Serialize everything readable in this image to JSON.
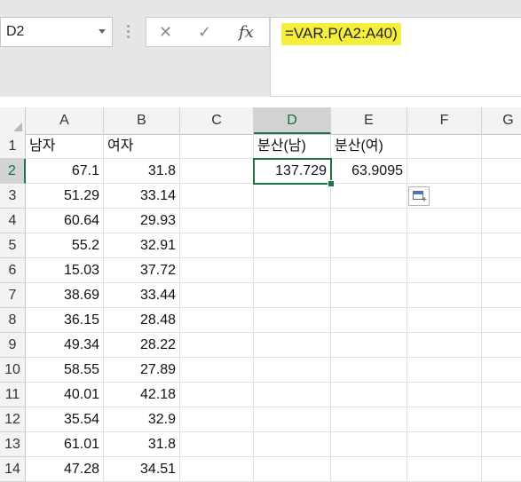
{
  "name_box": {
    "value": "D2"
  },
  "formula_bar": {
    "cancel_icon": "✕",
    "enter_icon": "✓",
    "fx_label": "fx",
    "formula": "=VAR.P(A2:A40)",
    "highlight_color": "#f5ee3a"
  },
  "columns": [
    "A",
    "B",
    "C",
    "D",
    "E",
    "F",
    "G"
  ],
  "rows": [
    {
      "num": "1",
      "a": "남자",
      "b": "여자",
      "d": "분산(남)",
      "e": "분산(여)"
    },
    {
      "num": "2",
      "a": "67.1",
      "b": "31.8",
      "d": "137.729",
      "e": "63.9095"
    },
    {
      "num": "3",
      "a": "51.29",
      "b": "33.14"
    },
    {
      "num": "4",
      "a": "60.64",
      "b": "29.93"
    },
    {
      "num": "5",
      "a": "55.2",
      "b": "32.91"
    },
    {
      "num": "6",
      "a": "15.03",
      "b": "37.72"
    },
    {
      "num": "7",
      "a": "38.69",
      "b": "33.44"
    },
    {
      "num": "8",
      "a": "36.15",
      "b": "28.48"
    },
    {
      "num": "9",
      "a": "49.34",
      "b": "28.22"
    },
    {
      "num": "10",
      "a": "58.55",
      "b": "27.89"
    },
    {
      "num": "11",
      "a": "40.01",
      "b": "42.18"
    },
    {
      "num": "12",
      "a": "35.54",
      "b": "32.9"
    },
    {
      "num": "13",
      "a": "61.01",
      "b": "31.8"
    },
    {
      "num": "14",
      "a": "47.28",
      "b": "34.51"
    }
  ],
  "active_cell": {
    "column": "D",
    "row": "2",
    "accent_color": "#217346"
  }
}
